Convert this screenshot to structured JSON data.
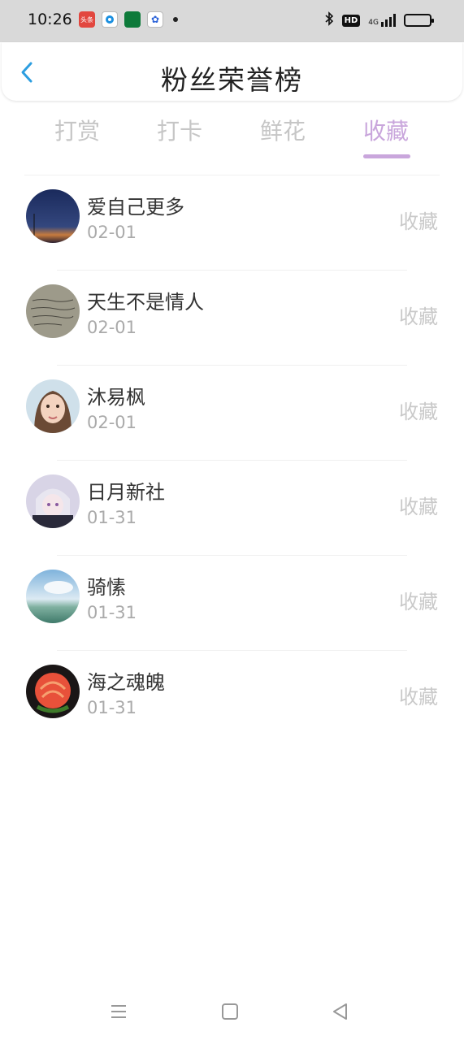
{
  "status": {
    "time": "10:26",
    "hd": "HD",
    "network": "4G",
    "notif_labels": [
      "头条"
    ]
  },
  "header": {
    "title": "粉丝荣誉榜"
  },
  "tabs": [
    {
      "label": "打赏",
      "active": false
    },
    {
      "label": "打卡",
      "active": false
    },
    {
      "label": "鲜花",
      "active": false
    },
    {
      "label": "收藏",
      "active": true
    }
  ],
  "colors": {
    "accent": "#c9a6dc",
    "inactive_tab": "#c6c6c6"
  },
  "fans": [
    {
      "name": "爱自己更多",
      "date": "02-01",
      "action": "收藏"
    },
    {
      "name": "天生不是情人",
      "date": "02-01",
      "action": "收藏"
    },
    {
      "name": "沐易枫",
      "date": "02-01",
      "action": "收藏"
    },
    {
      "name": "日月新社",
      "date": "01-31",
      "action": "收藏"
    },
    {
      "name": "骑愫",
      "date": "01-31",
      "action": "收藏"
    },
    {
      "name": "海之魂魄",
      "date": "01-31",
      "action": "收藏"
    }
  ],
  "icons": {
    "back": "chevron-left-icon",
    "menu": "menu-icon",
    "home": "home-square-icon",
    "back_nav": "triangle-back-icon"
  }
}
